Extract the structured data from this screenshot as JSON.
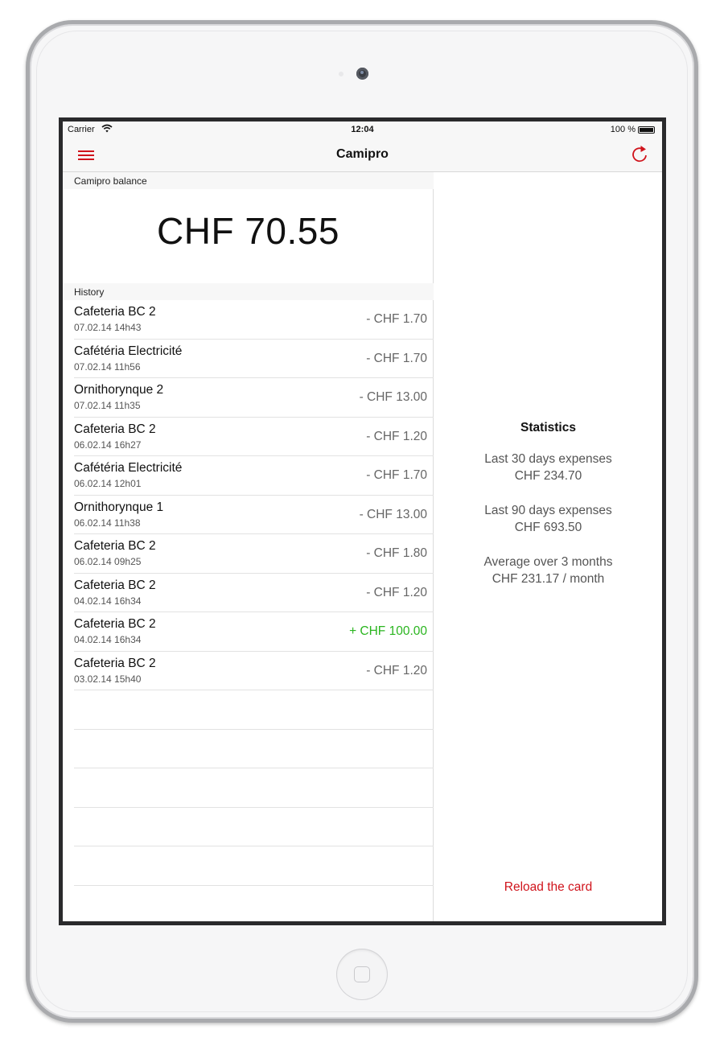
{
  "status_bar": {
    "carrier": "Carrier",
    "time": "12:04",
    "battery": "100 %"
  },
  "nav": {
    "title": "Camipro",
    "menu_icon": "hamburger-menu-icon",
    "refresh_icon": "refresh-icon",
    "accent_color": "#d0141c"
  },
  "balance_section": {
    "header": "Camipro balance",
    "amount": "CHF 70.55"
  },
  "history": {
    "header": "History",
    "items": [
      {
        "name": "Cafeteria BC 2",
        "date": "07.02.14 14h43",
        "amount": "- CHF 1.70",
        "positive": false
      },
      {
        "name": "Cafétéria Electricité",
        "date": "07.02.14 11h56",
        "amount": "- CHF 1.70",
        "positive": false
      },
      {
        "name": "Ornithorynque 2",
        "date": "07.02.14 11h35",
        "amount": "- CHF 13.00",
        "positive": false
      },
      {
        "name": "Cafeteria BC 2",
        "date": "06.02.14 16h27",
        "amount": "- CHF 1.20",
        "positive": false
      },
      {
        "name": "Cafétéria Electricité",
        "date": "06.02.14 12h01",
        "amount": "- CHF 1.70",
        "positive": false
      },
      {
        "name": "Ornithorynque 1",
        "date": "06.02.14 11h38",
        "amount": "- CHF 13.00",
        "positive": false
      },
      {
        "name": "Cafeteria BC 2",
        "date": "06.02.14 09h25",
        "amount": "- CHF 1.80",
        "positive": false
      },
      {
        "name": "Cafeteria BC 2",
        "date": "04.02.14 16h34",
        "amount": "- CHF 1.20",
        "positive": false
      },
      {
        "name": "Cafeteria BC 2",
        "date": "04.02.14 16h34",
        "amount": "+ CHF 100.00",
        "positive": true
      },
      {
        "name": "Cafeteria BC 2",
        "date": "03.02.14 15h40",
        "amount": "- CHF 1.20",
        "positive": false
      }
    ],
    "positive_color": "#2ab51f"
  },
  "statistics": {
    "title": "Statistics",
    "last30_label": "Last 30 days expenses",
    "last30_value": "CHF 234.70",
    "last90_label": "Last 90 days expenses",
    "last90_value": "CHF 693.50",
    "avg_label": "Average over 3 months",
    "avg_value": "CHF 231.17 / month"
  },
  "reload_label": "Reload the card"
}
